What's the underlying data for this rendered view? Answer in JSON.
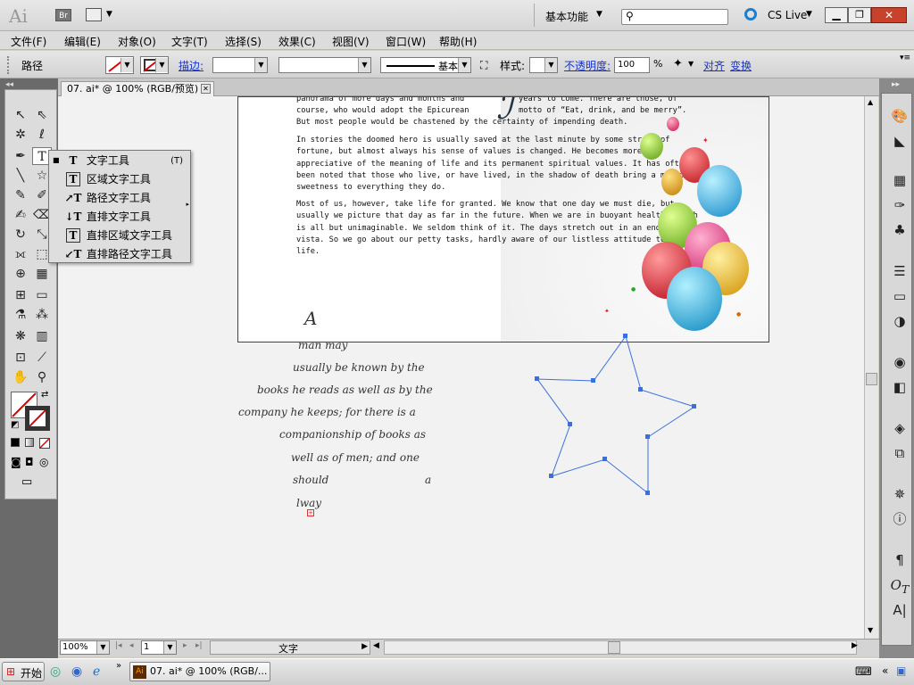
{
  "app": {
    "logo": "Ai",
    "bridge": "Br",
    "workspace": "基本功能",
    "cslive": "CS Live"
  },
  "menu": [
    "文件(F)",
    "编辑(E)",
    "对象(O)",
    "文字(T)",
    "选择(S)",
    "效果(C)",
    "视图(V)",
    "窗口(W)",
    "帮助(H)"
  ],
  "control": {
    "selection_label": "路径",
    "stroke_label": "描边:",
    "stroke_style": "基本",
    "style_label": "样式:",
    "opacity_label": "不透明度:",
    "opacity_value": "100",
    "opacity_unit": "%",
    "align_label": "对齐",
    "transform_label": "变换"
  },
  "document": {
    "tab_title": "07. ai* @ 100% (RGB/预览)"
  },
  "flyout": {
    "items": [
      {
        "label": "文字工具",
        "shortcut": "(T)",
        "icon": "T"
      },
      {
        "label": "区域文字工具",
        "shortcut": "",
        "icon": "T"
      },
      {
        "label": "路径文字工具",
        "shortcut": "",
        "icon": "↗T"
      },
      {
        "label": "直排文字工具",
        "shortcut": "",
        "icon": "↓T"
      },
      {
        "label": "直排区域文字工具",
        "shortcut": "",
        "icon": "T"
      },
      {
        "label": "直排路径文字工具",
        "shortcut": "",
        "icon": "↙T"
      }
    ]
  },
  "artboard": {
    "para1_lines": [
      "panorama of more days and months and",
      "course, who would adopt the Epicurean",
      "But most people would be chastened by the  certainty of impending death."
    ],
    "para1_right": [
      "years to    come. There are those, of",
      "motto of “Eat, drink, and be merry”."
    ],
    "para2": "In stories the doomed hero is usually saved at the last minute by some stroke of fortune, but almost always his sense of values is changed. He becomes more appreciative of the meaning of life and its permanent spiritual values. It has often been noted that those who live, or have lived, in the shadow of death bring a mellow sweetness to everything they do.",
    "para3": "Most of us, however, take life for granted. We know that one day we must die, but usually we picture that day as far in the future. When we are in buoyant health, death is all but unimaginable. We seldom think of it. The days stretch out in an endless vista. So we go about our petty tasks, hardly aware of our listless attitude toward life.",
    "initial": "A"
  },
  "script_lines": [
    "man may",
    "usually be known by the",
    "books he reads as well as by the",
    "company he keeps; for there is a",
    "companionship of books as",
    "well as of men; and one",
    "should",
    "a",
    "lway"
  ],
  "status": {
    "zoom": "100%",
    "page": "1",
    "mode": "文字"
  },
  "taskbar": {
    "start": "开始",
    "task": "07. ai* @ 100% (RGB/..."
  },
  "colors": {
    "accent_link": "#1a34c8",
    "selection_blue": "#3b6fe0"
  }
}
